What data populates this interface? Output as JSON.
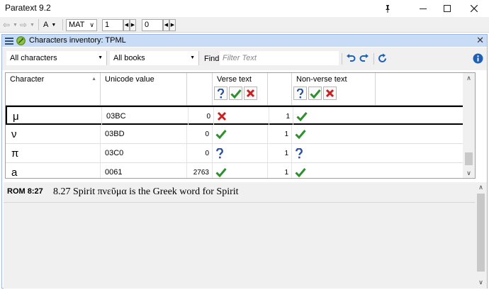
{
  "window": {
    "title": "Paratext 9.2"
  },
  "toolbar": {
    "font_label": "A",
    "book": "MAT",
    "chapter": "1",
    "verse": "0"
  },
  "panel": {
    "title": "Characters inventory: TPML"
  },
  "filters": {
    "characters": "All characters",
    "books": "All books",
    "find_label": "Find",
    "filter_placeholder": "Filter Text"
  },
  "grid": {
    "columns": {
      "character": "Character",
      "unicode": "Unicode value",
      "verse": "Verse text",
      "nonverse": "Non-verse text"
    },
    "rows": [
      {
        "char": "μ",
        "code": "03BC",
        "verse_count": "0",
        "verse_status": "invalid",
        "nonverse_count": "1",
        "nonverse_status": "valid"
      },
      {
        "char": "ν",
        "code": "03BD",
        "verse_count": "0",
        "verse_status": "valid",
        "nonverse_count": "1",
        "nonverse_status": "valid"
      },
      {
        "char": "π",
        "code": "03C0",
        "verse_count": "0",
        "verse_status": "unknown",
        "nonverse_count": "1",
        "nonverse_status": "unknown"
      },
      {
        "char": "a",
        "code": "0061",
        "verse_count": "2763",
        "verse_status": "valid",
        "nonverse_count": "1",
        "nonverse_status": "valid"
      }
    ]
  },
  "detail": {
    "reference": "ROM 8:27",
    "text": "8.27 Spirit πνεῦμα is the Greek word for Spirit"
  },
  "colors": {
    "panel_header": "#c9dcf6",
    "check": "#2f8f2f",
    "cross": "#cc1f1f",
    "question": "#2a4fa0",
    "accent": "#1f5fb4"
  }
}
